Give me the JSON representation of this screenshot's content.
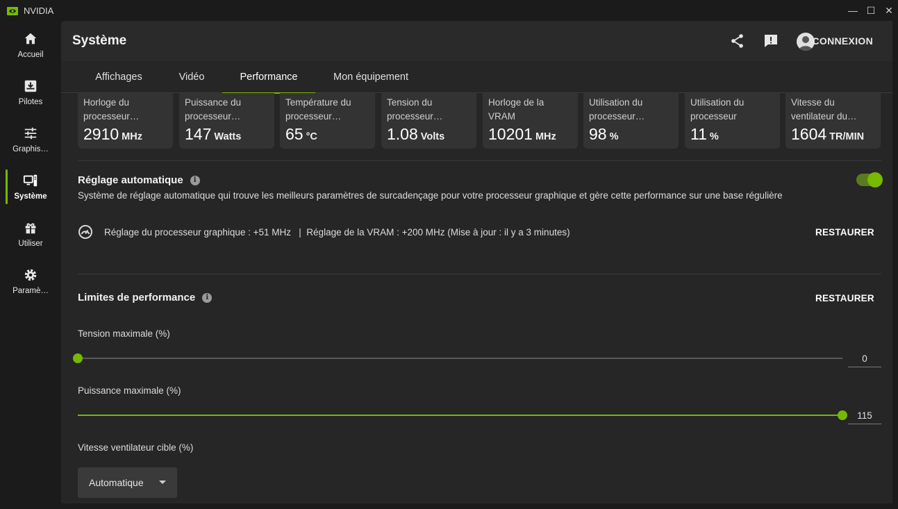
{
  "window": {
    "title": "NVIDIA",
    "minimize_glyph": "—",
    "maximize_glyph": "☐",
    "close_glyph": "✕"
  },
  "nav": {
    "items": [
      {
        "label": "Accueil",
        "icon": "home-icon"
      },
      {
        "label": "Pilotes",
        "icon": "download-icon"
      },
      {
        "label": "Graphis…",
        "icon": "sliders-icon"
      },
      {
        "label": "Système",
        "icon": "system-icon",
        "active": true
      },
      {
        "label": "Utiliser",
        "icon": "gift-icon"
      },
      {
        "label": "Paramè…",
        "icon": "gear-icon"
      }
    ]
  },
  "header": {
    "title": "Système",
    "share_icon": "share-icon",
    "feedback_icon": "feedback-icon",
    "login_label": "CONNEXION"
  },
  "tabs": [
    {
      "label": "Affichages"
    },
    {
      "label": "Vidéo"
    },
    {
      "label": "Performance",
      "active": true
    },
    {
      "label": "Mon équipement"
    }
  ],
  "metrics": [
    {
      "label": "Horloge du processeur…",
      "value": "2910",
      "unit": "MHz"
    },
    {
      "label": "Puissance du processeur…",
      "value": "147",
      "unit": "Watts"
    },
    {
      "label": "Température du processeur…",
      "value": "65",
      "unit": "°C"
    },
    {
      "label": "Tension du processeur…",
      "value": "1.08",
      "unit": "Volts"
    },
    {
      "label": "Horloge de la VRAM",
      "value": "10201",
      "unit": "MHz"
    },
    {
      "label": "Utilisation du processeur…",
      "value": "98",
      "unit": "%"
    },
    {
      "label": "Utilisation du processeur",
      "value": "11",
      "unit": "%"
    },
    {
      "label": "Vitesse du ventilateur du…",
      "value": "1604",
      "unit": "TR/MIN"
    }
  ],
  "auto_tuning": {
    "title": "Réglage automatique",
    "enabled": true,
    "description": "Système de réglage automatique qui trouve les meilleurs paramètres de surcadençage pour votre processeur graphique et gère cette performance sur une base régulière",
    "status": "Réglage du processeur graphique : +51 MHz   |  Réglage de la VRAM : +200 MHz (Mise à jour : il y a 3 minutes)",
    "restore_label": "RESTAURER"
  },
  "limits": {
    "title": "Limites de performance",
    "restore_label": "RESTAURER",
    "voltage": {
      "label": "Tension maximale (%)",
      "value": "0",
      "fraction": 0.0
    },
    "power": {
      "label": "Puissance maximale (%)",
      "value": "115",
      "fraction": 1.0
    },
    "fan": {
      "label": "Vitesse ventilateur cible (%)",
      "selected": "Automatique"
    }
  },
  "colors": {
    "accent": "#76b900",
    "background": "#1b1b1b",
    "panel": "#262626",
    "card": "#333333"
  }
}
